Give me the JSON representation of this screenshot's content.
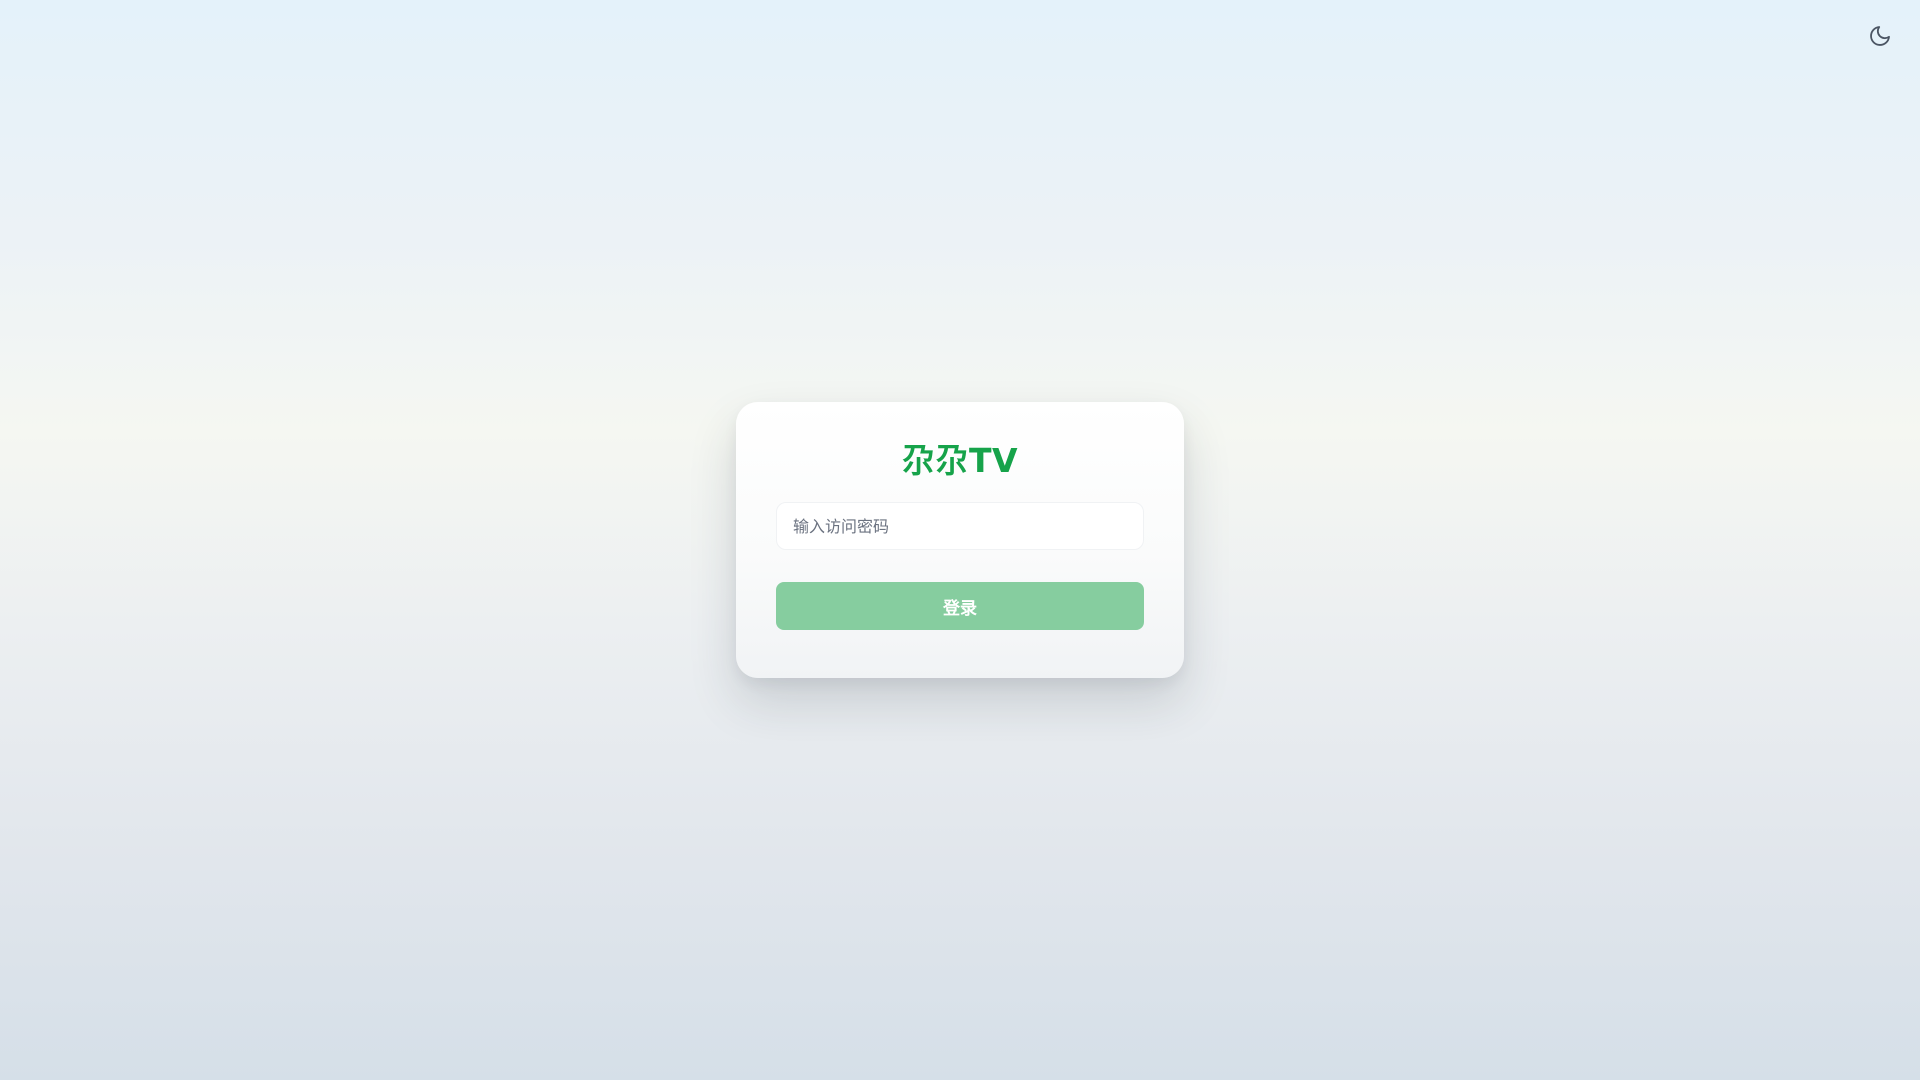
{
  "header": {
    "theme_toggle_icon": "moon-icon"
  },
  "login": {
    "title": "尕尕TV",
    "password_placeholder": "输入访问密码",
    "password_value": "",
    "submit_label": "登录"
  },
  "colors": {
    "brand": "#16a34a",
    "button": "#86cd9f",
    "button_text": "#ffffff",
    "card": "#ffffff",
    "background_top": "#e4f2fa",
    "background_bottom": "#d5dfe8"
  }
}
